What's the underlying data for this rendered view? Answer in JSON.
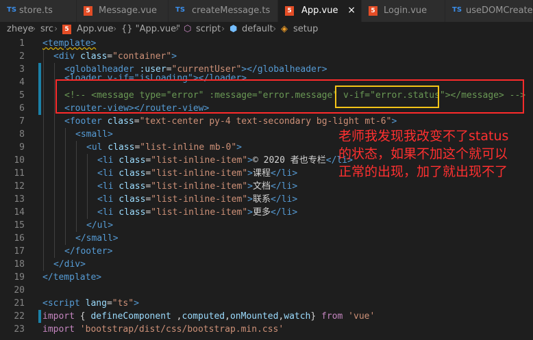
{
  "tabs": [
    {
      "icon": "ts",
      "label": "store.ts"
    },
    {
      "icon": "html5",
      "label": "Message.vue"
    },
    {
      "icon": "ts",
      "label": "createMessage.ts"
    },
    {
      "icon": "html5",
      "label": "App.vue",
      "active": true,
      "close": "×"
    },
    {
      "icon": "html5",
      "label": "Login.vue"
    },
    {
      "icon": "ts",
      "label": "useDOMCreate.ts"
    }
  ],
  "breadcrumb": {
    "parts": [
      "zheye",
      "src",
      "App.vue",
      "{} \"App.vue\"",
      "script",
      "default",
      "setup"
    ],
    "separator": "›"
  },
  "line_numbers": [
    "1",
    "2",
    "3",
    "4",
    "5",
    "6",
    "7",
    "8",
    "9",
    "10",
    "11",
    "12",
    "13",
    "14",
    "15",
    "16",
    "17",
    "18",
    "19",
    "20",
    "21",
    "22",
    "23"
  ],
  "code": {
    "l1": "<template>",
    "l2_a": "<div",
    "l2_b": " class",
    "l2_c": "=",
    "l2_d": "\"container\"",
    "l2_e": ">",
    "l3_a": "<globalheader",
    "l3_b": " :user",
    "l3_c": "=",
    "l3_d": "\"currentUser\"",
    "l3_e": "></globalheader>",
    "l4": "<loader v-if=\"isLoading\"></loader>",
    "l5_a": "<!-- <message type=\"error\" :message=\"error.message\" ",
    "l5_b": "v-if=\"error.status\"",
    "l5_c": "></message> -->",
    "l6": "<router-view></router-view>",
    "l7_a": "<footer",
    "l7_b": " class",
    "l7_c": "=",
    "l7_d": "\"text-center py-4 text-secondary bg-light mt-6\"",
    "l7_e": ">",
    "l8": "<small>",
    "l9_a": "<ul",
    "l9_b": " class",
    "l9_c": "=",
    "l9_d": "\"list-inline mb-0\"",
    "l9_e": ">",
    "li_open": "<li",
    "li_attr": " class",
    "li_eq": "=",
    "li_val": "\"list-inline-item\"",
    "li_gt": ">",
    "li_close": "</li>",
    "l10_text": "© 2020 者也专栏",
    "l11_text": "课程",
    "l12_text": "文档",
    "l13_text": "联系",
    "l14_text": "更多",
    "l15": "</ul>",
    "l16": "</small>",
    "l17": "</footer>",
    "l18": "</div>",
    "l19": "</template>",
    "l21_a": "<script",
    "l21_b": " lang",
    "l21_c": "=",
    "l21_d": "\"ts\"",
    "l21_e": ">",
    "l22_a": "import",
    "l22_b": " { ",
    "l22_c": "defineComponent",
    "l22_d": " ,",
    "l22_e": "computed",
    "l22_f": ",",
    "l22_g": "onMounted",
    "l22_h": ",",
    "l22_i": "watch",
    "l22_j": "} ",
    "l22_k": "from",
    "l22_l": " 'vue'",
    "l23_a": "import",
    "l23_b": " 'bootstrap/dist/css/bootstrap.min.css'"
  },
  "annotation": {
    "line1": "老师我发现我改变不了status",
    "line2": "的状态，如果不加这个就可以",
    "line3": "正常的出现，加了就出现不了"
  },
  "colors": {
    "annotation": "#ff3030",
    "red_box": "#ff2b2b",
    "yellow_box": "#f5c518",
    "git_modified": "#1b81a8"
  }
}
